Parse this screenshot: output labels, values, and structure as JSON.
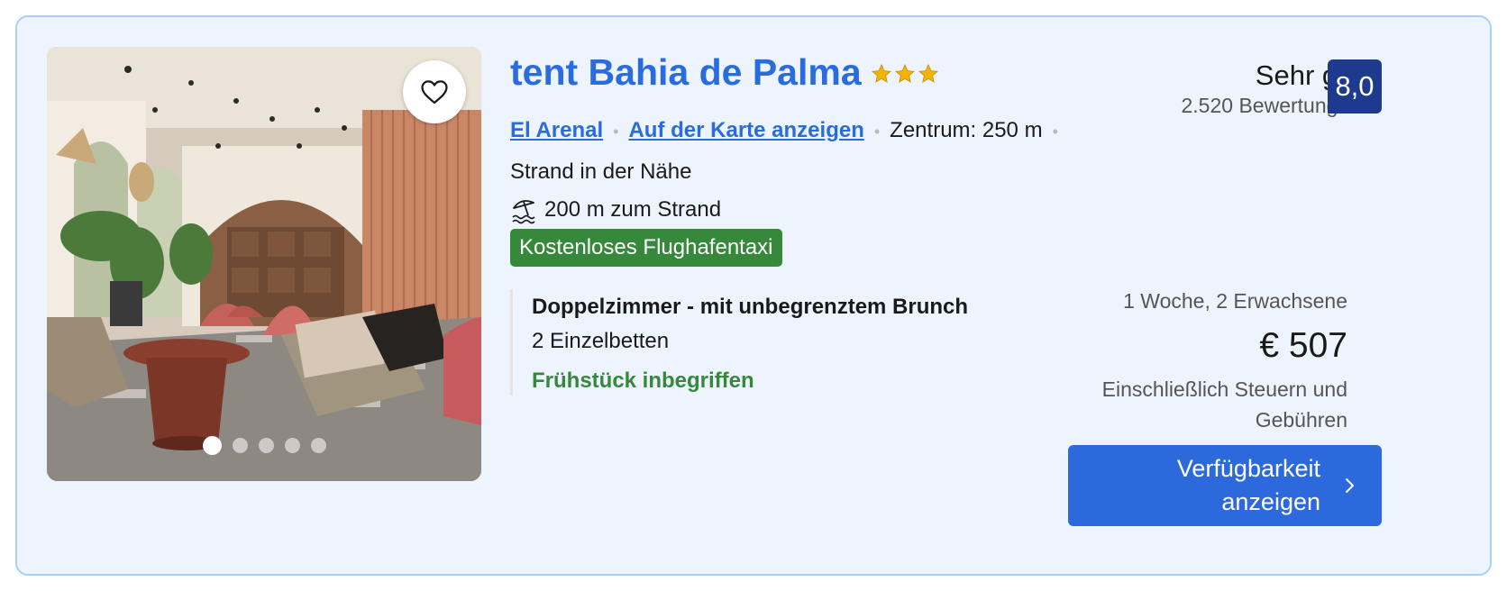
{
  "hotel": {
    "name": "tent Bahia de Palma",
    "stars": 3,
    "star_color": "#f5b400",
    "favorite_icon": "heart-outline-icon",
    "photo_count": 5,
    "active_photo_index": 0
  },
  "location": {
    "area_link": "El Arenal",
    "map_link": "Auf der Karte anzeigen",
    "center_distance": "Zentrum: 250 m",
    "nearby": "Strand in der Nähe",
    "beach_icon": "beach-umbrella-icon",
    "beach_distance": "200 m zum Strand"
  },
  "perk_badge": {
    "label": "Kostenloses Flughafentaxi",
    "color": "#36883b"
  },
  "room": {
    "name": "Doppelzimmer - mit unbegrenztem Brunch",
    "beds": "2 Einzelbetten",
    "breakfast": "Frühstück inbegriffen"
  },
  "review": {
    "label": "Sehr gut",
    "count": "2.520 Bewertungen",
    "score": "8,0",
    "score_color": "#1e3a8f"
  },
  "price": {
    "stay": "1 Woche, 2 Erwachsene",
    "amount": "€ 507",
    "taxes_line1": "Einschließlich Steuern und",
    "taxes_line2": "Gebühren"
  },
  "cta": {
    "line1": "Verfügbarkeit",
    "line2": "anzeigen",
    "color": "#2b69dd",
    "icon": "chevron-right-icon"
  },
  "colors": {
    "accent": "#2a6ce0",
    "card_bg": "#eef4fe",
    "card_border": "#a9d1f5"
  }
}
